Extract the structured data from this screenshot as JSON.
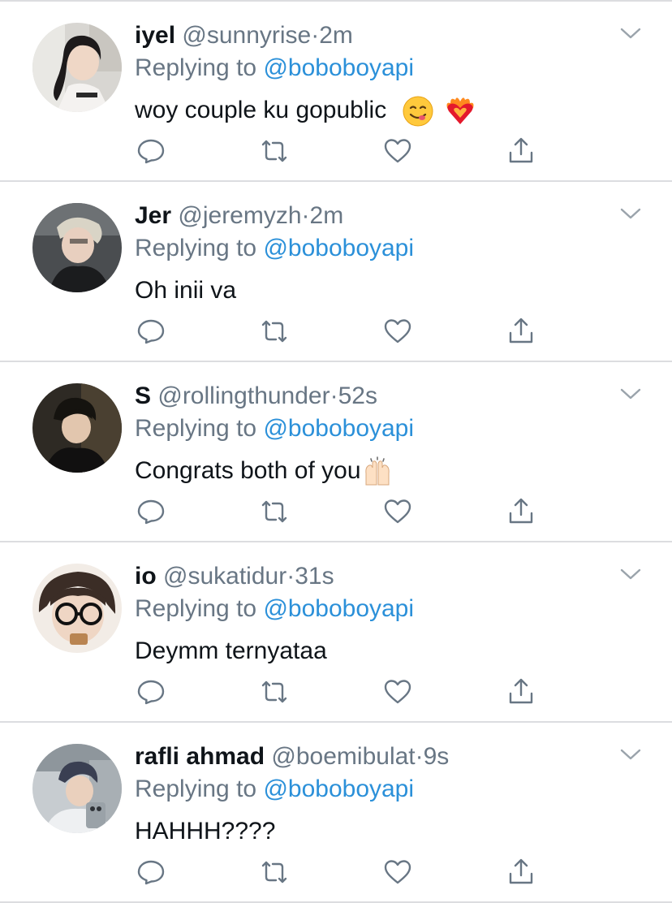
{
  "colors": {
    "text_primary": "#0f1419",
    "text_secondary": "#687684",
    "link": "#2b90d9",
    "icon": "#687684",
    "divider": "#dcdde0"
  },
  "separator": "·",
  "reply_prefix": "Replying to",
  "icons": {
    "reply": "reply-icon",
    "retweet": "retweet-icon",
    "like": "heart-icon",
    "share": "share-icon",
    "menu": "chevron-down-icon"
  },
  "tweets": [
    {
      "display_name": "iyel",
      "handle": "@sunnyrise",
      "time": "2m",
      "replying_to": "@boboboyapi",
      "text": "woy couple ku gopublic",
      "emojis": [
        "yum-face-emoji",
        "heart-on-fire-emoji"
      ]
    },
    {
      "display_name": "Jer",
      "handle": "@jeremyzh",
      "time": "2m",
      "replying_to": "@boboboyapi",
      "text": "Oh inii va",
      "emojis": []
    },
    {
      "display_name": "S",
      "handle": "@rollingthunder",
      "time": "52s",
      "replying_to": "@boboboyapi",
      "text": "Congrats both of you",
      "emojis": [
        "raising-hands-emoji"
      ]
    },
    {
      "display_name": "io",
      "handle": "@sukatidur",
      "time": "31s",
      "replying_to": "@boboboyapi",
      "text": "Deymm ternyataa",
      "emojis": []
    },
    {
      "display_name": "rafli ahmad",
      "handle": "@boemibulat",
      "time": "9s",
      "replying_to": "@boboboyapi",
      "text": "HAHHH????",
      "emojis": []
    }
  ]
}
